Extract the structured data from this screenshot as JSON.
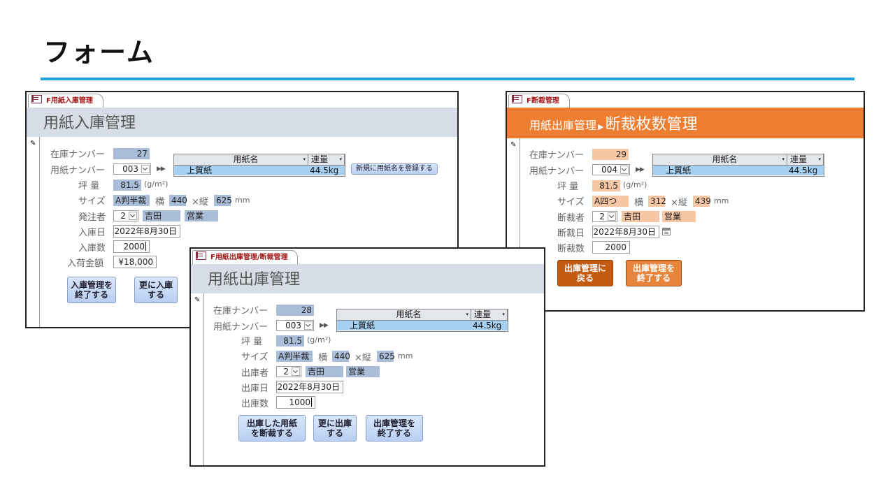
{
  "slide": {
    "title": "フォーム"
  },
  "form_nyuko": {
    "tab": "F用紙入庫管理",
    "header": "用紙入庫管理",
    "labels": {
      "stock_no": "在庫ナンバー",
      "paper_no": "用紙ナンバー",
      "tsubo": "坪  量",
      "size": "サイズ",
      "orderer": "発注者",
      "date": "入庫日",
      "qty": "入庫数",
      "amount": "入荷金額"
    },
    "stock_no": "27",
    "paper_no": "003",
    "arrows": "▶▶",
    "sub_headers": {
      "name": "用紙名",
      "weight": "連量"
    },
    "sub_row": {
      "name": "上質紙",
      "weight": "44.5kg"
    },
    "register_button": "新規に用紙名を登録する",
    "tsubo": "81.5",
    "tsubo_unit": "(g/m²)",
    "size": {
      "name": "A判半裁",
      "w_label": "横",
      "w": "440",
      "h_label": "×縦",
      "h": "625",
      "unit": "mm"
    },
    "orderer": {
      "id": "2",
      "name": "吉田",
      "dept": "営業"
    },
    "date": "2022年8月30日",
    "qty": "2000",
    "amount": "¥18,000",
    "buttons": {
      "finish": "入庫管理を\n終了する",
      "more": "更に入庫\nする"
    }
  },
  "form_dansai": {
    "tab": "F断裁管理",
    "header_small": "用紙出庫管理",
    "header_arrow": "▶",
    "header": "断裁枚数管理",
    "labels": {
      "stock_no": "在庫ナンバー",
      "paper_no": "用紙ナンバー",
      "tsubo": "坪  量",
      "size": "サイズ",
      "cutter": "断裁者",
      "date": "断裁日",
      "qty": "断裁数"
    },
    "stock_no": "29",
    "paper_no": "004",
    "arrows": "▶▶",
    "sub_headers": {
      "name": "用紙名",
      "weight": "連量"
    },
    "sub_row": {
      "name": "上質紙",
      "weight": "44.5kg"
    },
    "tsubo": "81.5",
    "tsubo_unit": "(g/m²)",
    "size": {
      "name": "A四つ",
      "w_label": "横",
      "w": "312",
      "h_label": "×縦",
      "h": "439",
      "unit": "mm"
    },
    "cutter": {
      "id": "2",
      "name": "吉田",
      "dept": "営業"
    },
    "date": "2022年8月30日",
    "qty": "2000",
    "buttons": {
      "back": "出庫管理に\n戻る",
      "finish": "出庫管理を\n終了する"
    }
  },
  "form_shukko": {
    "tab": "F用紙出庫管理/断裁管理",
    "header": "用紙出庫管理",
    "labels": {
      "stock_no": "在庫ナンバー",
      "paper_no": "用紙ナンバー",
      "tsubo": "坪  量",
      "size": "サイズ",
      "shipper": "出庫者",
      "date": "出庫日",
      "qty": "出庫数"
    },
    "stock_no": "28",
    "paper_no": "003",
    "arrows": "▶▶",
    "sub_headers": {
      "name": "用紙名",
      "weight": "連量"
    },
    "sub_row": {
      "name": "上質紙",
      "weight": "44.5kg"
    },
    "tsubo": "81.5",
    "tsubo_unit": "(g/m²)",
    "size": {
      "name": "A判半裁",
      "w_label": "横",
      "w": "440",
      "h_label": "×縦",
      "h": "625",
      "unit": "mm"
    },
    "shipper": {
      "id": "2",
      "name": "吉田",
      "dept": "営業"
    },
    "date": "2022年8月30日",
    "qty": "1000",
    "buttons": {
      "cut": "出庫した用紙\nを断裁する",
      "more": "更に出庫\nする",
      "finish": "出庫管理を\n終了する"
    }
  }
}
